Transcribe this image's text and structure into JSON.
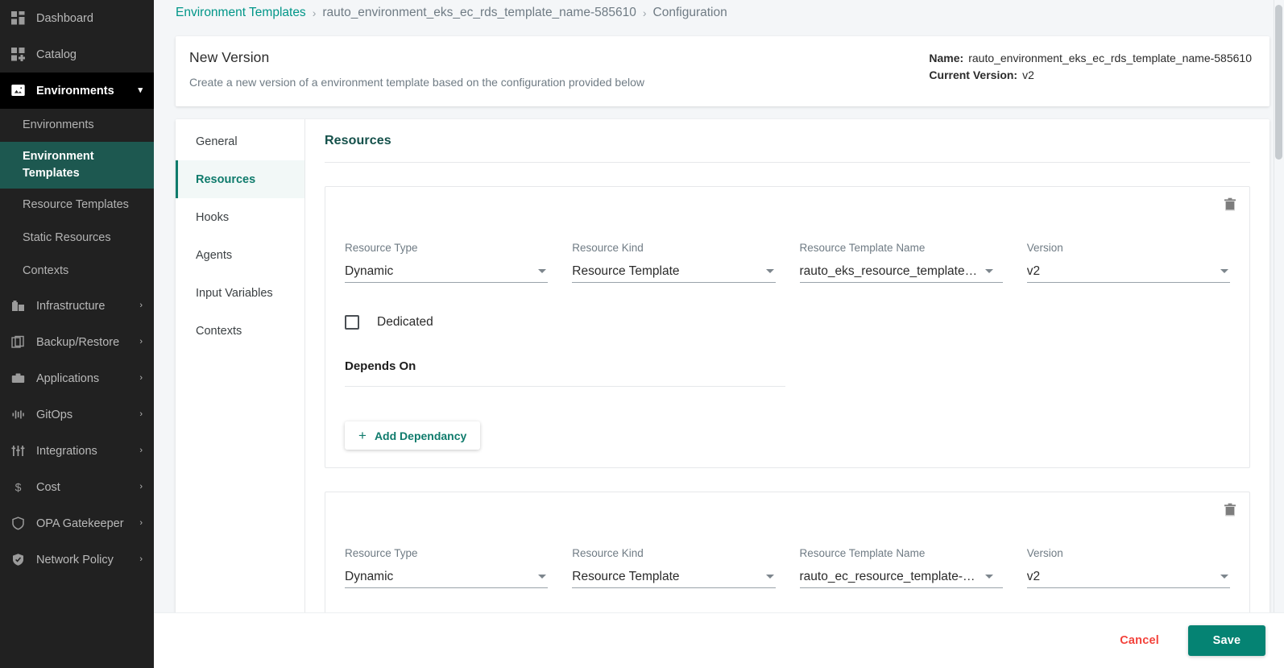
{
  "sidebar": {
    "items": [
      {
        "label": "Dashboard",
        "icon": "dashboard-grid-icon",
        "state": "normal",
        "chevron": ""
      },
      {
        "label": "Catalog",
        "icon": "catalog-grid-icon",
        "state": "normal",
        "chevron": ""
      },
      {
        "label": "Environments",
        "icon": "environments-image-icon",
        "state": "expanded",
        "chevron": "chevron-down-icon"
      }
    ],
    "sub_items": [
      {
        "label": "Environments",
        "active": false
      },
      {
        "label": "Environment Templates",
        "active": true
      },
      {
        "label": "Resource Templates",
        "active": false
      },
      {
        "label": "Static Resources",
        "active": false
      },
      {
        "label": "Contexts",
        "active": false
      }
    ],
    "items_bottom": [
      {
        "label": "Infrastructure",
        "icon": "building-icon",
        "chevron": "chevron-right-icon"
      },
      {
        "label": "Backup/Restore",
        "icon": "copy-icon",
        "chevron": "chevron-right-icon"
      },
      {
        "label": "Applications",
        "icon": "briefcase-icon",
        "chevron": "chevron-right-icon"
      },
      {
        "label": "GitOps",
        "icon": "waveform-icon",
        "chevron": "chevron-right-icon"
      },
      {
        "label": "Integrations",
        "icon": "sliders-icon",
        "chevron": "chevron-right-icon"
      },
      {
        "label": "Cost",
        "icon": "dollar-icon",
        "chevron": "chevron-right-icon"
      },
      {
        "label": "OPA Gatekeeper",
        "icon": "shield-icon",
        "chevron": "chevron-right-icon"
      },
      {
        "label": "Network Policy",
        "icon": "shield-check-icon",
        "chevron": "chevron-right-icon"
      }
    ]
  },
  "breadcrumb": {
    "root": "Environment Templates",
    "middle": "rauto_environment_eks_ec_rds_template_name-585610",
    "current": "Configuration",
    "separator": "›"
  },
  "header": {
    "title": "New Version",
    "subtitle": "Create a new version of a environment template based on the configuration provided below",
    "name_key": "Name:",
    "name_value": "rauto_environment_eks_ec_rds_template_name-585610",
    "version_key": "Current Version:",
    "version_value": "v2"
  },
  "tabs": [
    {
      "label": "General",
      "active": false
    },
    {
      "label": "Resources",
      "active": true
    },
    {
      "label": "Hooks",
      "active": false
    },
    {
      "label": "Agents",
      "active": false
    },
    {
      "label": "Input Variables",
      "active": false
    },
    {
      "label": "Contexts",
      "active": false
    }
  ],
  "panel": {
    "title": "Resources",
    "labels": {
      "resource_type": "Resource Type",
      "resource_kind": "Resource Kind",
      "resource_template_name": "Resource Template Name",
      "version": "Version"
    },
    "dedicated_label": "Dedicated",
    "depends_on_label": "Depends On",
    "add_dependancy_label": "Add Dependancy",
    "plus_glyph": "+",
    "delete_icon": "trash-icon"
  },
  "resources": [
    {
      "resource_type": "Dynamic",
      "resource_kind": "Resource Template",
      "resource_template_name": "rauto_eks_resource_template…",
      "version": "v2",
      "dedicated_checked": false
    },
    {
      "resource_type": "Dynamic",
      "resource_kind": "Resource Template",
      "resource_template_name": "rauto_ec_resource_template-…",
      "version": "v2",
      "dedicated_checked": false
    }
  ],
  "footer": {
    "cancel_label": "Cancel",
    "save_label": "Save"
  },
  "colors": {
    "accent_teal": "#0f7b6c",
    "brand_teal": "#009688",
    "sidebar_bg": "#212121",
    "sidebar_active": "#1d5850",
    "save_green": "#058373",
    "cancel_red": "#f3423b",
    "page_bg": "#f4f6f8"
  }
}
